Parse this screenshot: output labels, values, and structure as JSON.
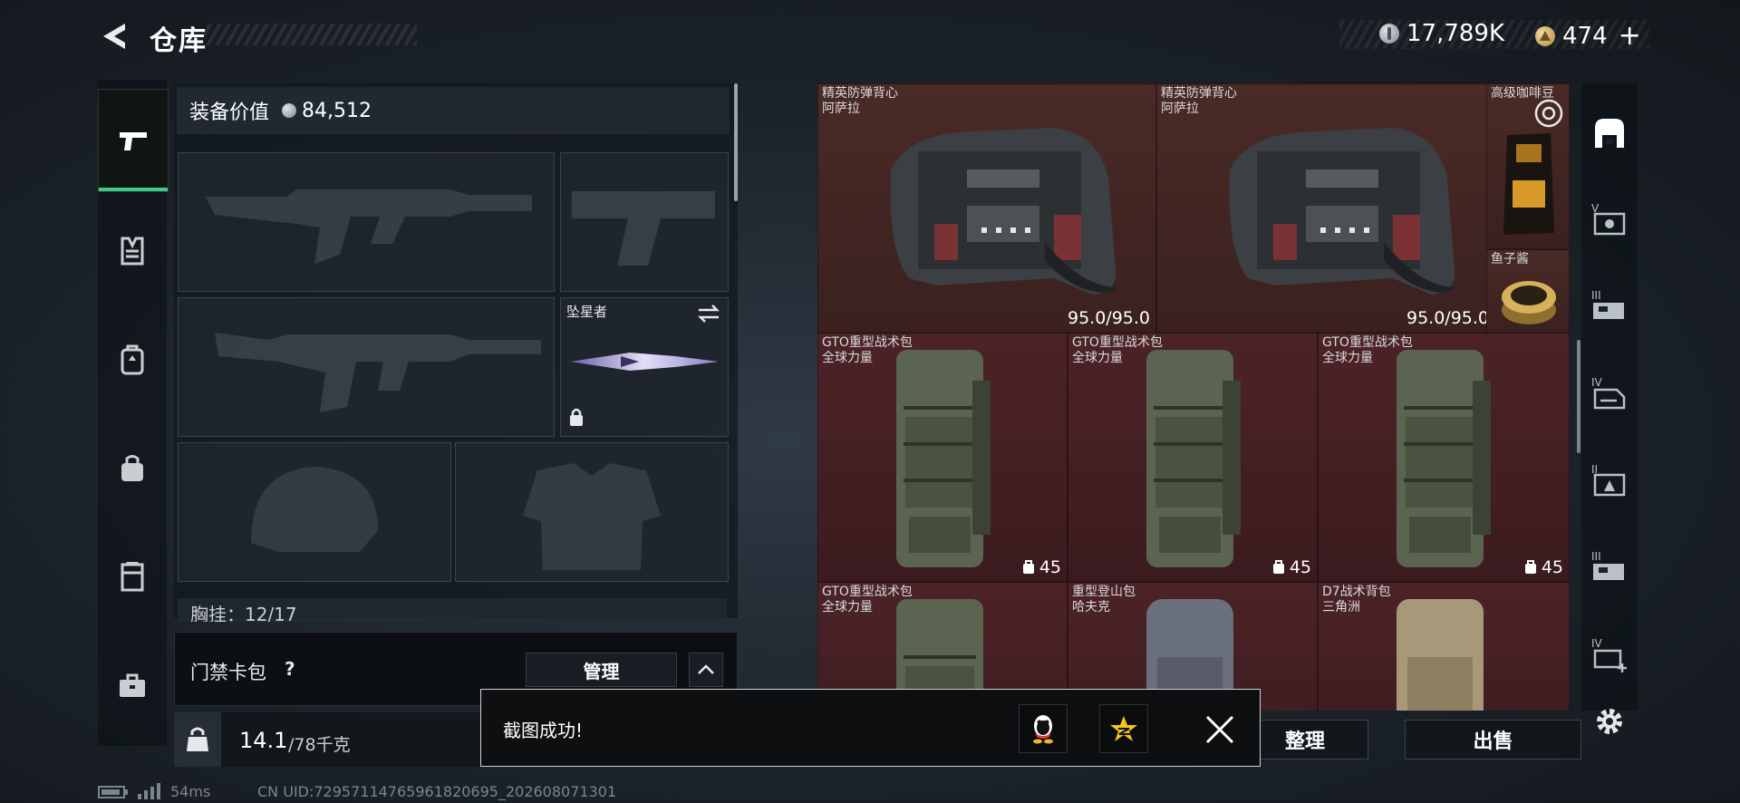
{
  "header": {
    "title": "仓库",
    "currency_silver": "17,789K",
    "currency_gold": "474",
    "plus": "+"
  },
  "left_nav": {
    "items": [
      {
        "icon": "pistol-icon",
        "active": true
      },
      {
        "icon": "vest-icon",
        "active": false
      },
      {
        "icon": "backpack-icon",
        "active": false
      },
      {
        "icon": "bag-icon",
        "active": false
      },
      {
        "icon": "locker-icon",
        "active": false
      },
      {
        "icon": "case-icon",
        "active": false
      }
    ]
  },
  "loadout": {
    "value_label": "装备价值",
    "value_amount": "84,512",
    "melee_label": "坠星者",
    "chest_rig_label": "胸挂：12/17",
    "chest_rig_help": "?"
  },
  "card_pack": {
    "label": "门禁卡包",
    "help": "?",
    "manage_label": "管理"
  },
  "weight": {
    "current": "14.1",
    "max": "/78千克",
    "icon_text": "KG"
  },
  "storage": {
    "items": [
      {
        "name": "精英防弹背心",
        "brand": "阿萨拉",
        "durability": "95.0/95.0",
        "type": "vest"
      },
      {
        "name": "精英防弹背心",
        "brand": "阿萨拉",
        "durability": "95.0/95.0",
        "type": "vest"
      },
      {
        "name": "高级咖啡豆",
        "brand": "",
        "type": "coffee"
      },
      {
        "name": "鱼子酱",
        "brand": "",
        "type": "caviar"
      },
      {
        "name": "GTO重型战术包",
        "brand": "全球力量",
        "capacity": "45",
        "type": "pack-green"
      },
      {
        "name": "GTO重型战术包",
        "brand": "全球力量",
        "capacity": "45",
        "type": "pack-green"
      },
      {
        "name": "GTO重型战术包",
        "brand": "全球力量",
        "capacity": "45",
        "type": "pack-green"
      },
      {
        "name": "GTO重型战术包",
        "brand": "全球力量",
        "type": "pack-green"
      },
      {
        "name": "重型登山包",
        "brand": "哈夫克",
        "type": "pack-grey"
      },
      {
        "name": "D7战术背包",
        "brand": "三角洲",
        "type": "pack-tan"
      }
    ]
  },
  "right_nav": {
    "items": [
      {
        "icon": "warehouse-icon",
        "label": ""
      },
      {
        "icon": "storage-v-icon",
        "label": "V"
      },
      {
        "icon": "storage-iii-icon",
        "label": "III"
      },
      {
        "icon": "storage-iv-icon",
        "label": "IV"
      },
      {
        "icon": "storage-ii-icon",
        "label": "II"
      },
      {
        "icon": "storage-iii-b-icon",
        "label": "III"
      },
      {
        "icon": "storage-iv-b-icon",
        "label": "IV"
      }
    ]
  },
  "actions": {
    "sort_label": "整理",
    "sell_label": "出售"
  },
  "toast": {
    "message": "截图成功!"
  },
  "status_bar": {
    "ping": "54ms",
    "uid": "CN UID:72957114765961820695_202608071301"
  },
  "colors": {
    "accent_green": "#3ecb8a",
    "vest_cell": "#4a2a26",
    "pack_cell": "#4c2327"
  }
}
